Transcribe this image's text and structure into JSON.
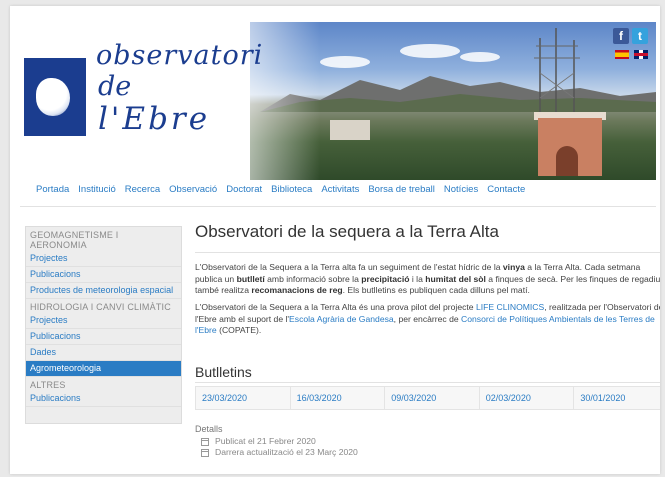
{
  "brand": {
    "logo_line1": "observatori",
    "logo_line2": "de",
    "logo_line3": "l'Ebre"
  },
  "social": {
    "facebook": "f",
    "twitter": "t"
  },
  "flags": [
    "es",
    "uk"
  ],
  "nav": [
    "Portada",
    "Institució",
    "Recerca",
    "Observació",
    "Doctorat",
    "Biblioteca",
    "Activitats",
    "Borsa de treball",
    "Notícies",
    "Contacte"
  ],
  "sidebar": {
    "sections": [
      {
        "heading": "GEOMAGNETISME I AERONOMIA",
        "items": [
          "Projectes",
          "Publicacions",
          "Productes de meteorologia espacial"
        ]
      },
      {
        "heading": "HIDROLOGIA I CANVI CLIMÀTIC",
        "items": [
          "Projectes",
          "Publicacions",
          "Dades",
          "Agrometeorologia"
        ]
      },
      {
        "heading": "ALTRES",
        "items": [
          "Publicacions"
        ]
      }
    ],
    "active": "Agrometeorologia"
  },
  "main": {
    "title": "Observatori de la sequera a la Terra Alta",
    "p1": {
      "t1": "L'Observatori de la Sequera a la Terra alta fa un seguiment de l'estat hídric de la ",
      "b1": "vinya",
      "t2": " a la Terra Alta. Cada setmana publica un ",
      "b2": "butlletí",
      "t3": " amb informació sobre la ",
      "b3": "precipitació",
      "t4": " i la ",
      "b4": "humitat del sòl",
      "t5": " a finques de secà. Per les finques de regadiu també realitza ",
      "b5": "recomanacions de reg",
      "t6": ". Els butlletins es publiquen cada dilluns pel matí."
    },
    "p2": {
      "t1": "L'Observatori de la Sequera a la Terra Alta és una prova pilot del projecte ",
      "l1": "LIFE CLINOMICS",
      "t2": ", realitzada per l'Observatori de l'Ebre amb el suport de l'",
      "l2": "Escola Agrària de Gandesa",
      "t3": ", per encàrrec de ",
      "l3": "Consorci de Polítiques Ambientals de les Terres de l'Ebre",
      "t4": " (COPATE)."
    }
  },
  "butlletins": {
    "title": "Butlletins",
    "dates": [
      "23/03/2020",
      "16/03/2020",
      "09/03/2020",
      "02/03/2020",
      "30/01/2020"
    ]
  },
  "details": {
    "title": "Detalls",
    "published": "Publicat el 21 Febrer 2020",
    "updated": "Darrera actualització el 23 Març 2020"
  }
}
